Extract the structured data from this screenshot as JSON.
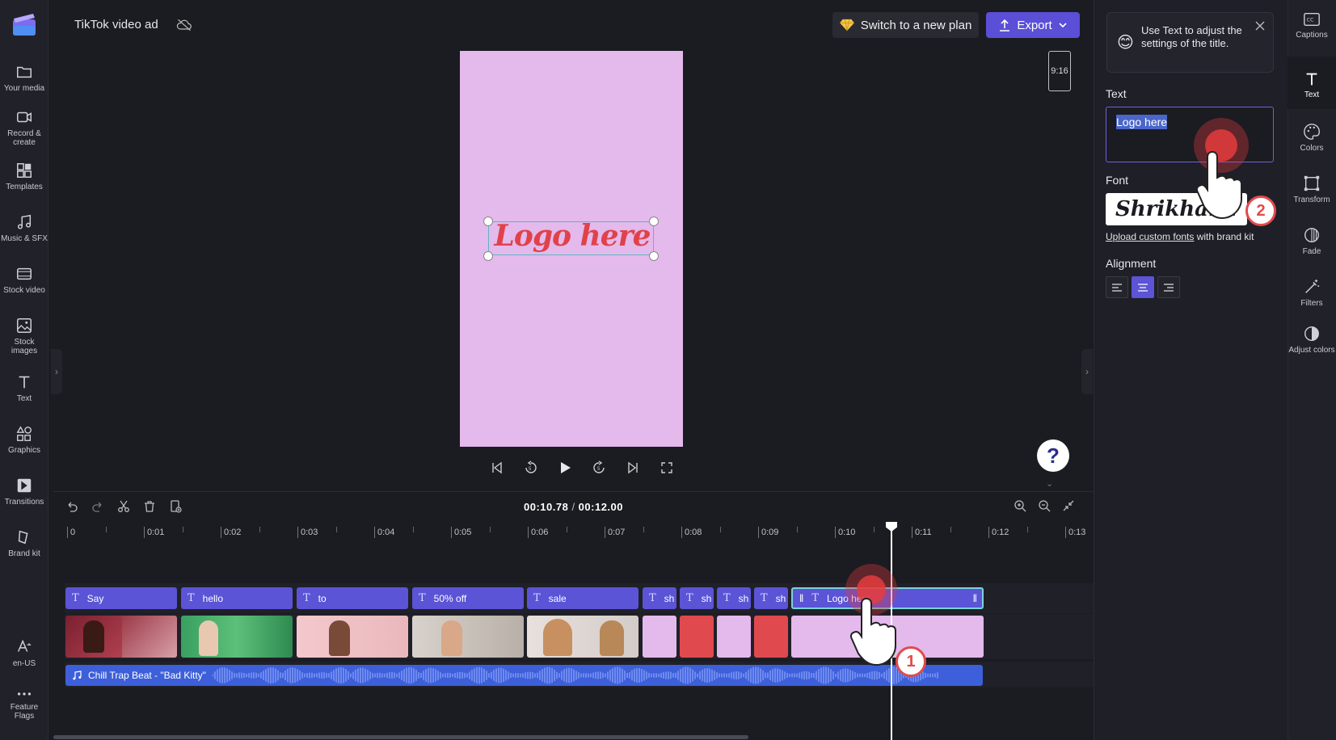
{
  "app": {
    "project_title": "TikTok video ad"
  },
  "left_nav": [
    {
      "label": "Your media",
      "icon": "folder-icon"
    },
    {
      "label": "Record & create",
      "icon": "camera-icon"
    },
    {
      "label": "Templates",
      "icon": "templates-icon"
    },
    {
      "label": "Music & SFX",
      "icon": "music-icon"
    },
    {
      "label": "Stock video",
      "icon": "film-icon"
    },
    {
      "label": "Stock images",
      "icon": "image-icon"
    },
    {
      "label": "Text",
      "icon": "text-icon"
    },
    {
      "label": "Graphics",
      "icon": "shapes-icon"
    },
    {
      "label": "Transitions",
      "icon": "transitions-icon"
    },
    {
      "label": "Brand kit",
      "icon": "brand-icon"
    }
  ],
  "left_nav_bottom": [
    {
      "label": "en-US",
      "icon": "language-icon"
    },
    {
      "label": "Feature Flags",
      "icon": "more-icon"
    }
  ],
  "header": {
    "upgrade_label": "Switch to a new plan",
    "export_label": "Export"
  },
  "preview": {
    "title_text": "Logo here",
    "aspect_ratio": "9:16",
    "canvas_color": "#e4b9ec",
    "title_color": "#e0424a"
  },
  "timeline": {
    "current_time": "00:10.78",
    "total_time": "00:12.00",
    "ruler_labels": [
      "0",
      "0:01",
      "0:02",
      "0:03",
      "0:04",
      "0:05",
      "0:06",
      "0:07",
      "0:08",
      "0:09",
      "0:10",
      "0:11",
      "0:12",
      "0:13"
    ],
    "text_clips": [
      "Say",
      "hello",
      "to",
      "50% off",
      "sale",
      "sh",
      "sh",
      "sh",
      "sh",
      "Logo here"
    ],
    "audio_clip": "Chill Trap Beat - \"Bad Kitty\""
  },
  "properties": {
    "tip": "Use Text to adjust the settings of the title.",
    "text_label": "Text",
    "text_value": "Logo here",
    "font_label": "Font",
    "font_value": "Shrikhand",
    "upload_link": "Upload custom fonts",
    "upload_suffix": " with brand kit",
    "alignment_label": "Alignment"
  },
  "right_rail": [
    {
      "label": "Captions",
      "icon": "captions-icon"
    },
    {
      "label": "Text",
      "icon": "text-icon"
    },
    {
      "label": "Colors",
      "icon": "palette-icon"
    },
    {
      "label": "Transform",
      "icon": "transform-icon"
    },
    {
      "label": "Fade",
      "icon": "fade-icon"
    },
    {
      "label": "Filters",
      "icon": "filters-icon"
    },
    {
      "label": "Adjust colors",
      "icon": "adjust-icon"
    }
  ],
  "tutorial": {
    "step1": "1",
    "step2": "2"
  },
  "colors": {
    "accent": "#5b54d6",
    "audio": "#3d5fd9",
    "selection": "#7ad3d6"
  }
}
